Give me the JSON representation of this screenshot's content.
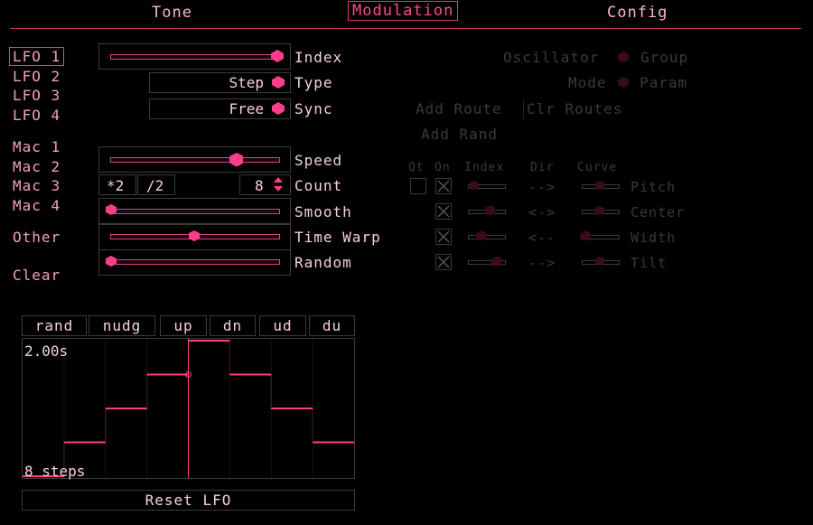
{
  "tabs": [
    {
      "label": "Tone"
    },
    {
      "label": "Modulation"
    },
    {
      "label": "Config"
    }
  ],
  "sidebar": {
    "lfos": [
      "LFO 1",
      "LFO 2",
      "LFO 3",
      "LFO 4"
    ],
    "macs": [
      "Mac 1",
      "Mac 2",
      "Mac 3",
      "Mac 4"
    ],
    "other": "Other",
    "clear": "Clear"
  },
  "params": {
    "index_label": "Index",
    "type_label": "Type",
    "type_value": "Step",
    "sync_label": "Sync",
    "sync_value": "Free",
    "speed_label": "Speed",
    "count_label": "Count",
    "count_mul": "*2",
    "count_div": "/2",
    "count_value": "8",
    "smooth_label": "Smooth",
    "timewarp_label": "Time Warp",
    "random_label": "Random",
    "levels": {
      "index": 1.0,
      "speed": 0.75,
      "smooth": 0.0,
      "timewarp": 0.5,
      "random": 0.0
    }
  },
  "routing": {
    "oscillator_label": "Oscillator",
    "group_label": "Group",
    "mode_label": "Mode",
    "param_label": "Param",
    "add_route": "Add Route",
    "clr_routes": "Clr Routes",
    "add_rand": "Add Rand",
    "headers": {
      "qt": "Qt",
      "on": "On",
      "index": "Index",
      "dir": "Dir",
      "curve": "Curve"
    },
    "rows": [
      {
        "dir": "-->",
        "target": "Pitch"
      },
      {
        "dir": "<->",
        "target": "Center"
      },
      {
        "dir": "<--",
        "target": "Width"
      },
      {
        "dir": "-->",
        "target": "Tilt"
      }
    ]
  },
  "shape_buttons": [
    "rand",
    "nudg",
    "up",
    "dn",
    "ud",
    "du"
  ],
  "graph": {
    "time_label": "2.00s",
    "steps_label": "8 steps",
    "step_values": [
      0.0,
      0.25,
      0.5,
      0.75,
      1.0,
      0.75,
      0.5,
      0.25
    ]
  },
  "reset_label": "Reset LFO",
  "colors": {
    "accent": "#ff3d8a",
    "dim": "#3a3a3a",
    "text": "#f6d0dc"
  }
}
